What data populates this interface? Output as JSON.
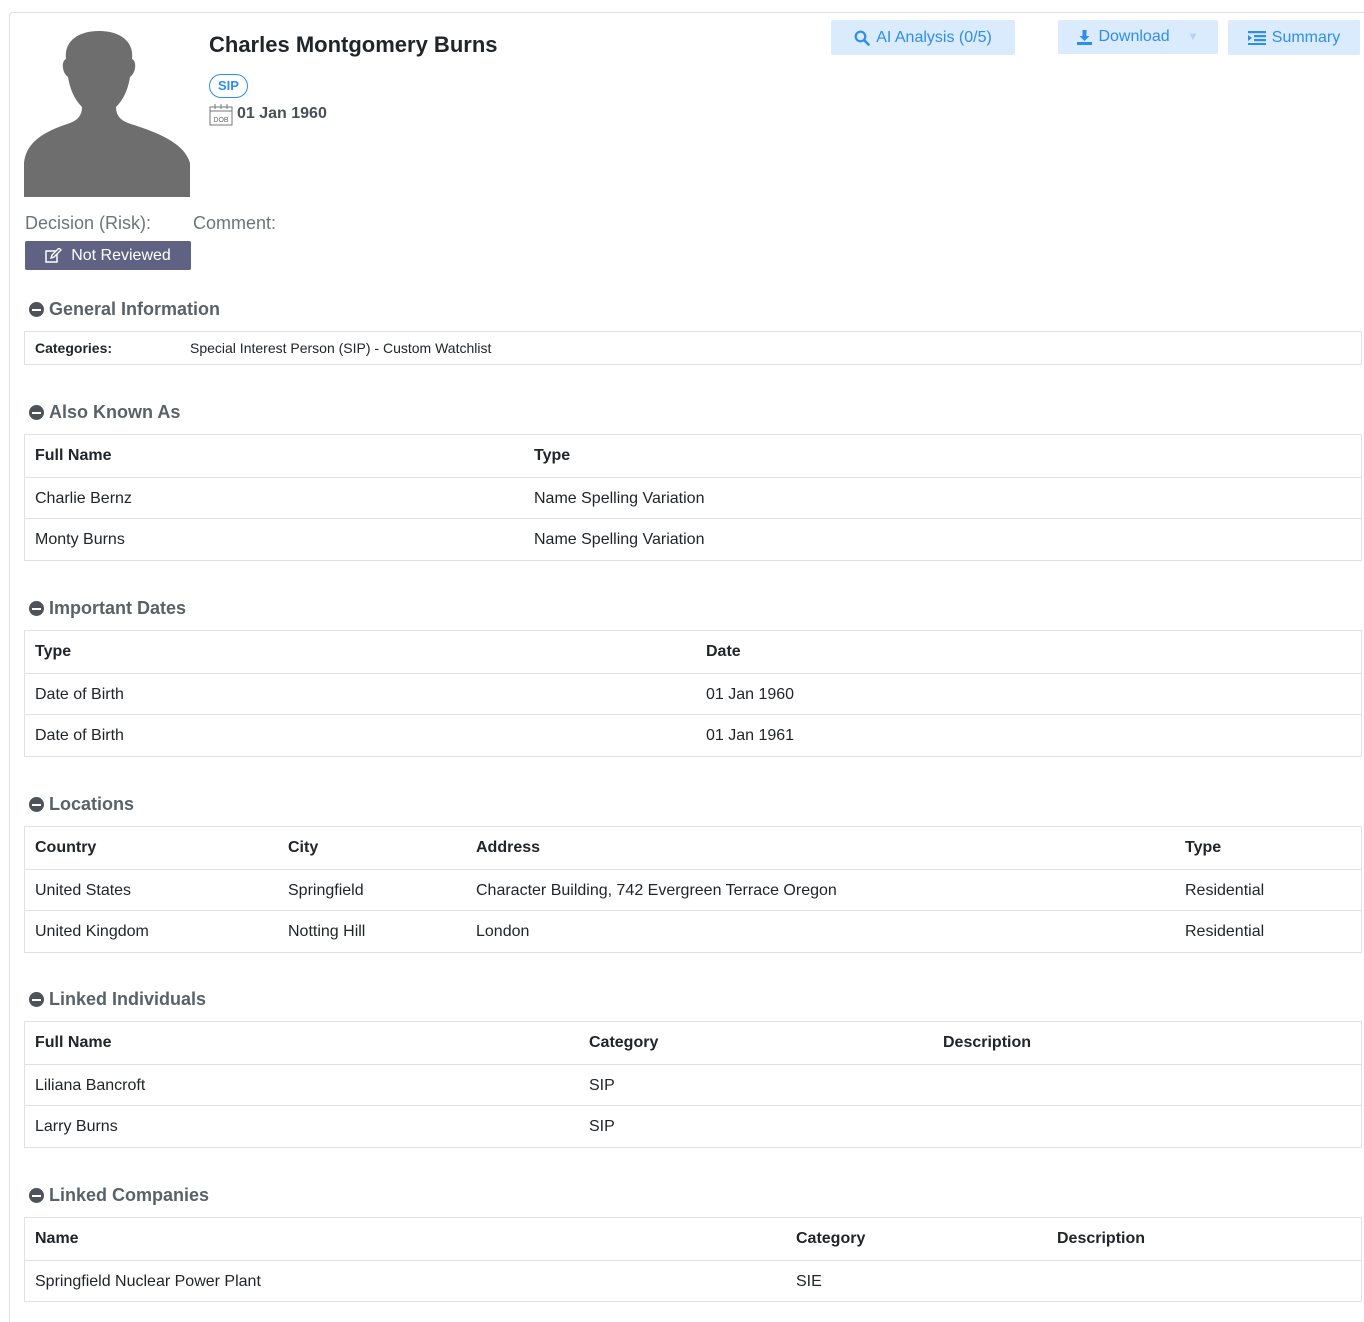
{
  "profile": {
    "name": "Charles Montgomery Burns",
    "badge": "SIP",
    "dob_icon_label": "DOB",
    "dob": "01 Jan 1960"
  },
  "toolbar": {
    "ai_label": "AI Analysis (0/5)",
    "download_label": "Download",
    "summary_label": "Summary"
  },
  "decision": {
    "decision_label": "Decision (Risk):",
    "comment_label": "Comment:",
    "status_button": "Not Reviewed"
  },
  "general": {
    "title": "General Information",
    "categories_label": "Categories:",
    "categories_value": "Special Interest Person (SIP) - Custom Watchlist"
  },
  "aka": {
    "title": "Also Known As",
    "headers": [
      "Full Name",
      "Type"
    ],
    "rows": [
      [
        "Charlie Bernz",
        "Name Spelling Variation"
      ],
      [
        "Monty Burns",
        "Name Spelling Variation"
      ]
    ]
  },
  "dates": {
    "title": "Important Dates",
    "headers": [
      "Type",
      "Date"
    ],
    "rows": [
      [
        "Date of Birth",
        "01 Jan 1960"
      ],
      [
        "Date of Birth",
        "01 Jan 1961"
      ]
    ]
  },
  "locations": {
    "title": "Locations",
    "headers": [
      "Country",
      "City",
      "Address",
      "Type"
    ],
    "rows": [
      [
        "United States",
        "Springfield",
        "Character Building, 742 Evergreen Terrace Oregon",
        "Residential"
      ],
      [
        "United Kingdom",
        "Notting Hill",
        "London",
        "Residential"
      ]
    ]
  },
  "individuals": {
    "title": "Linked Individuals",
    "headers": [
      "Full Name",
      "Category",
      "Description"
    ],
    "rows": [
      [
        "Liliana Bancroft",
        "SIP",
        ""
      ],
      [
        "Larry Burns",
        "SIP",
        ""
      ]
    ]
  },
  "companies": {
    "title": "Linked Companies",
    "headers": [
      "Name",
      "Category",
      "Description"
    ],
    "rows": [
      [
        "Springfield Nuclear Power Plant",
        "SIE",
        ""
      ]
    ]
  },
  "colors": {
    "accent": "#2f8ee8",
    "button_light": "#d9ebfc",
    "status_button": "#5f6283"
  }
}
